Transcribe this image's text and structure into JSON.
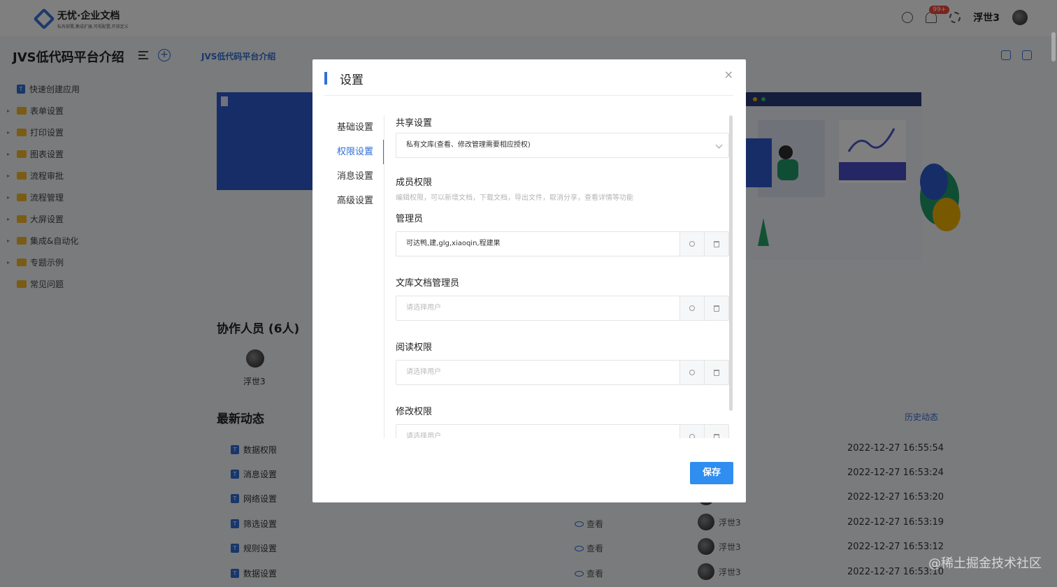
{
  "app": {
    "logo_title": "无忧·企业文档",
    "logo_subtitle": "私有部署,集成扩展,可视配置,开放定义",
    "notification_badge": "99+",
    "user_name": "浮世3"
  },
  "doc": {
    "title": "JVS低代码平台介绍",
    "breadcrumb": "JVS低代码平台介绍"
  },
  "tree": [
    {
      "label": "快速创建应用",
      "type": "doc",
      "arrow": ""
    },
    {
      "label": "表单设置",
      "type": "folder",
      "arrow": "▸"
    },
    {
      "label": "打印设置",
      "type": "folder",
      "arrow": "▸"
    },
    {
      "label": "图表设置",
      "type": "folder",
      "arrow": "▸"
    },
    {
      "label": "流程审批",
      "type": "folder",
      "arrow": "▸"
    },
    {
      "label": "流程管理",
      "type": "folder",
      "arrow": "▸"
    },
    {
      "label": "大屏设置",
      "type": "folder",
      "arrow": "▸"
    },
    {
      "label": "集成&自动化",
      "type": "folder",
      "arrow": "▸"
    },
    {
      "label": "专题示例",
      "type": "folder",
      "arrow": "▸"
    },
    {
      "label": "常见问题",
      "type": "folder",
      "arrow": ""
    }
  ],
  "main": {
    "collaborators_title": "协作人员 (6人)",
    "collaborator_name": "浮世3",
    "news_title": "最新动态",
    "history_link": "历史动态",
    "activities": [
      {
        "title": "数据权限",
        "action": "",
        "user": "",
        "time": "2022-12-27 16:55:54"
      },
      {
        "title": "消息设置",
        "action": "",
        "user": "",
        "time": "2022-12-27 16:53:24"
      },
      {
        "title": "网络设置",
        "action": "",
        "user": "",
        "time": "2022-12-27 16:53:20"
      },
      {
        "title": "筛选设置",
        "action": "查看",
        "user": "浮世3",
        "time": "2022-12-27 16:53:19"
      },
      {
        "title": "规则设置",
        "action": "查看",
        "user": "浮世3",
        "time": "2022-12-27 16:53:12"
      },
      {
        "title": "数据设置",
        "action": "查看",
        "user": "浮世3",
        "time": "2022-12-27 16:53:10"
      }
    ]
  },
  "dialog": {
    "title": "设置",
    "close": "×",
    "nav": [
      "基础设置",
      "权限设置",
      "消息设置",
      "高级设置"
    ],
    "active_nav": 1,
    "share_label": "共享设置",
    "share_value": "私有文库(查看、修改管理需要相应授权)",
    "member_label": "成员权限",
    "member_desc": "编辑权限，可以新增文档，下载文档，导出文件，取消分享，查看详情等功能",
    "admin_label": "管理员",
    "admin_value": "可达鸭,建,glg,xiaoqin,程建果",
    "doc_admin_label": "文库文档管理员",
    "doc_admin_placeholder": "请选择用户",
    "read_label": "阅读权限",
    "read_placeholder": "请选择用户",
    "edit_label": "修改权限",
    "edit_placeholder": "请选择用户",
    "save_label": "保存"
  },
  "watermark": "@稀土掘金技术社区",
  "colors": {
    "accent": "#2f6fd8",
    "save_button": "#2f8ef0",
    "folder": "#f5b82a"
  }
}
